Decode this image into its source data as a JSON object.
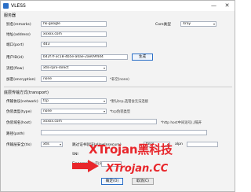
{
  "window": {
    "title": "VLESS",
    "minimize": "—",
    "close": "✕"
  },
  "server": {
    "heading": "服务器",
    "alias_label": "别名(remarks)",
    "alias_value": "hk-google",
    "core_label": "Core类型",
    "core_value": "Xray",
    "address_label": "地址(address)",
    "address_value": "xxxxx.com",
    "port_label": "端口(port)",
    "port_value": "443",
    "id_label": "用户ID(id)",
    "id_value": "b42f7f-3c18-4b5e-a0ae-2ae09f4d4",
    "generate_button": "生成",
    "flow_label": "流控(flow)",
    "flow_value": "xtls-rprx-direct",
    "encryption_label": "加密(encryption)",
    "encryption_value": "none",
    "encryption_hint": "*非空(none)"
  },
  "transport": {
    "heading": "底层传输方式(transport)",
    "network_label": "传输协议(network)",
    "network_value": "tcp",
    "network_hint": "*默认tcp,选错会无法连接",
    "type_label": "伪装类型(type)",
    "type_value": "none",
    "type_hint": "*tcp伪装类型",
    "host_label": "伪装域名(host)",
    "host_value": "xxxxx.com",
    "host_hint": "*http host中间逗号(,)隔开",
    "path_label": "路径(path)",
    "path_value": "",
    "security_label": "传输层安全(tls)",
    "security_value": "xtls",
    "allow_insecure_label": "跳过证书验证(allowInsecure)",
    "allow_insecure_value": "false",
    "alpn_label": "alpn",
    "sni_label": "SNI",
    "fingerprint_label": "Fingerprint(uTLS)"
  },
  "footer": {
    "confirm_button": "确定(O)",
    "cancel_button": "取消(C)"
  },
  "watermark": {
    "line1": "XTrojan黑科技",
    "line2": "XTrojan.CC"
  },
  "colors": {
    "accent": "#2b6fc7",
    "watermark": "#e8262b"
  }
}
